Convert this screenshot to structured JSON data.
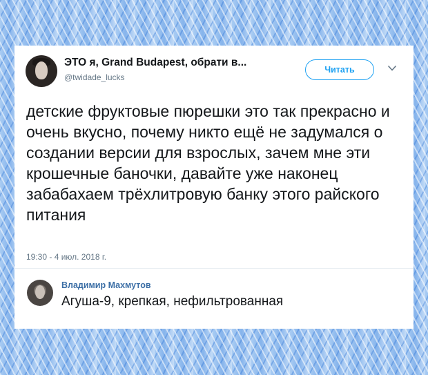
{
  "tweet": {
    "display_name": "ЭТО я, Grand Budapest, обрати в...",
    "handle": "@twidade_lucks",
    "follow_label": "Читать",
    "text": "детские фруктовые пюрешки это так прекрасно и очень вкусно, почему никто ещё не задумался о создании версии для взрослых, зачем мне эти крошечные баночки, давайте уже наконец забабахаем трёхлитровую банку этого райского питания",
    "timestamp": "19:30 - 4 июл. 2018 г."
  },
  "reply": {
    "author": "Владимир Махмутов",
    "text": "Агуша-9, крепкая, нефильтрованная"
  },
  "icons": {
    "more": "chevron-down-icon"
  },
  "colors": {
    "accent": "#1da1f2",
    "text": "#14171a",
    "secondary": "#657786",
    "reply_name": "#3b6ea5"
  }
}
